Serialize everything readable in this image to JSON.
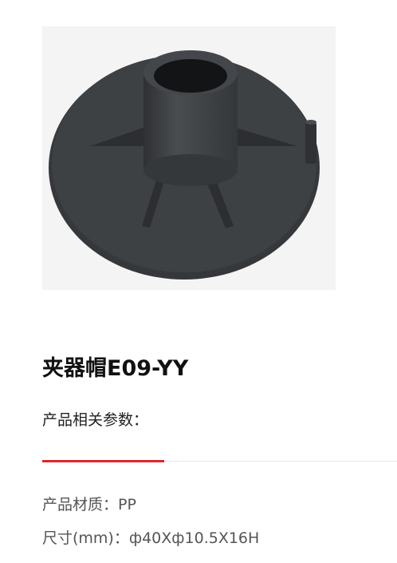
{
  "product": {
    "name": "夹器帽E09-YY",
    "image_alt": "夹器帽E09-YY"
  },
  "params": {
    "heading": "产品相关参数：",
    "material": "产品材质：PP",
    "size": "尺寸(mm)：ф40Xф10.5X16H"
  },
  "colors": {
    "accent": "#e1242b",
    "part": "#3a3d40",
    "image_bg": "#f4f4f4"
  }
}
